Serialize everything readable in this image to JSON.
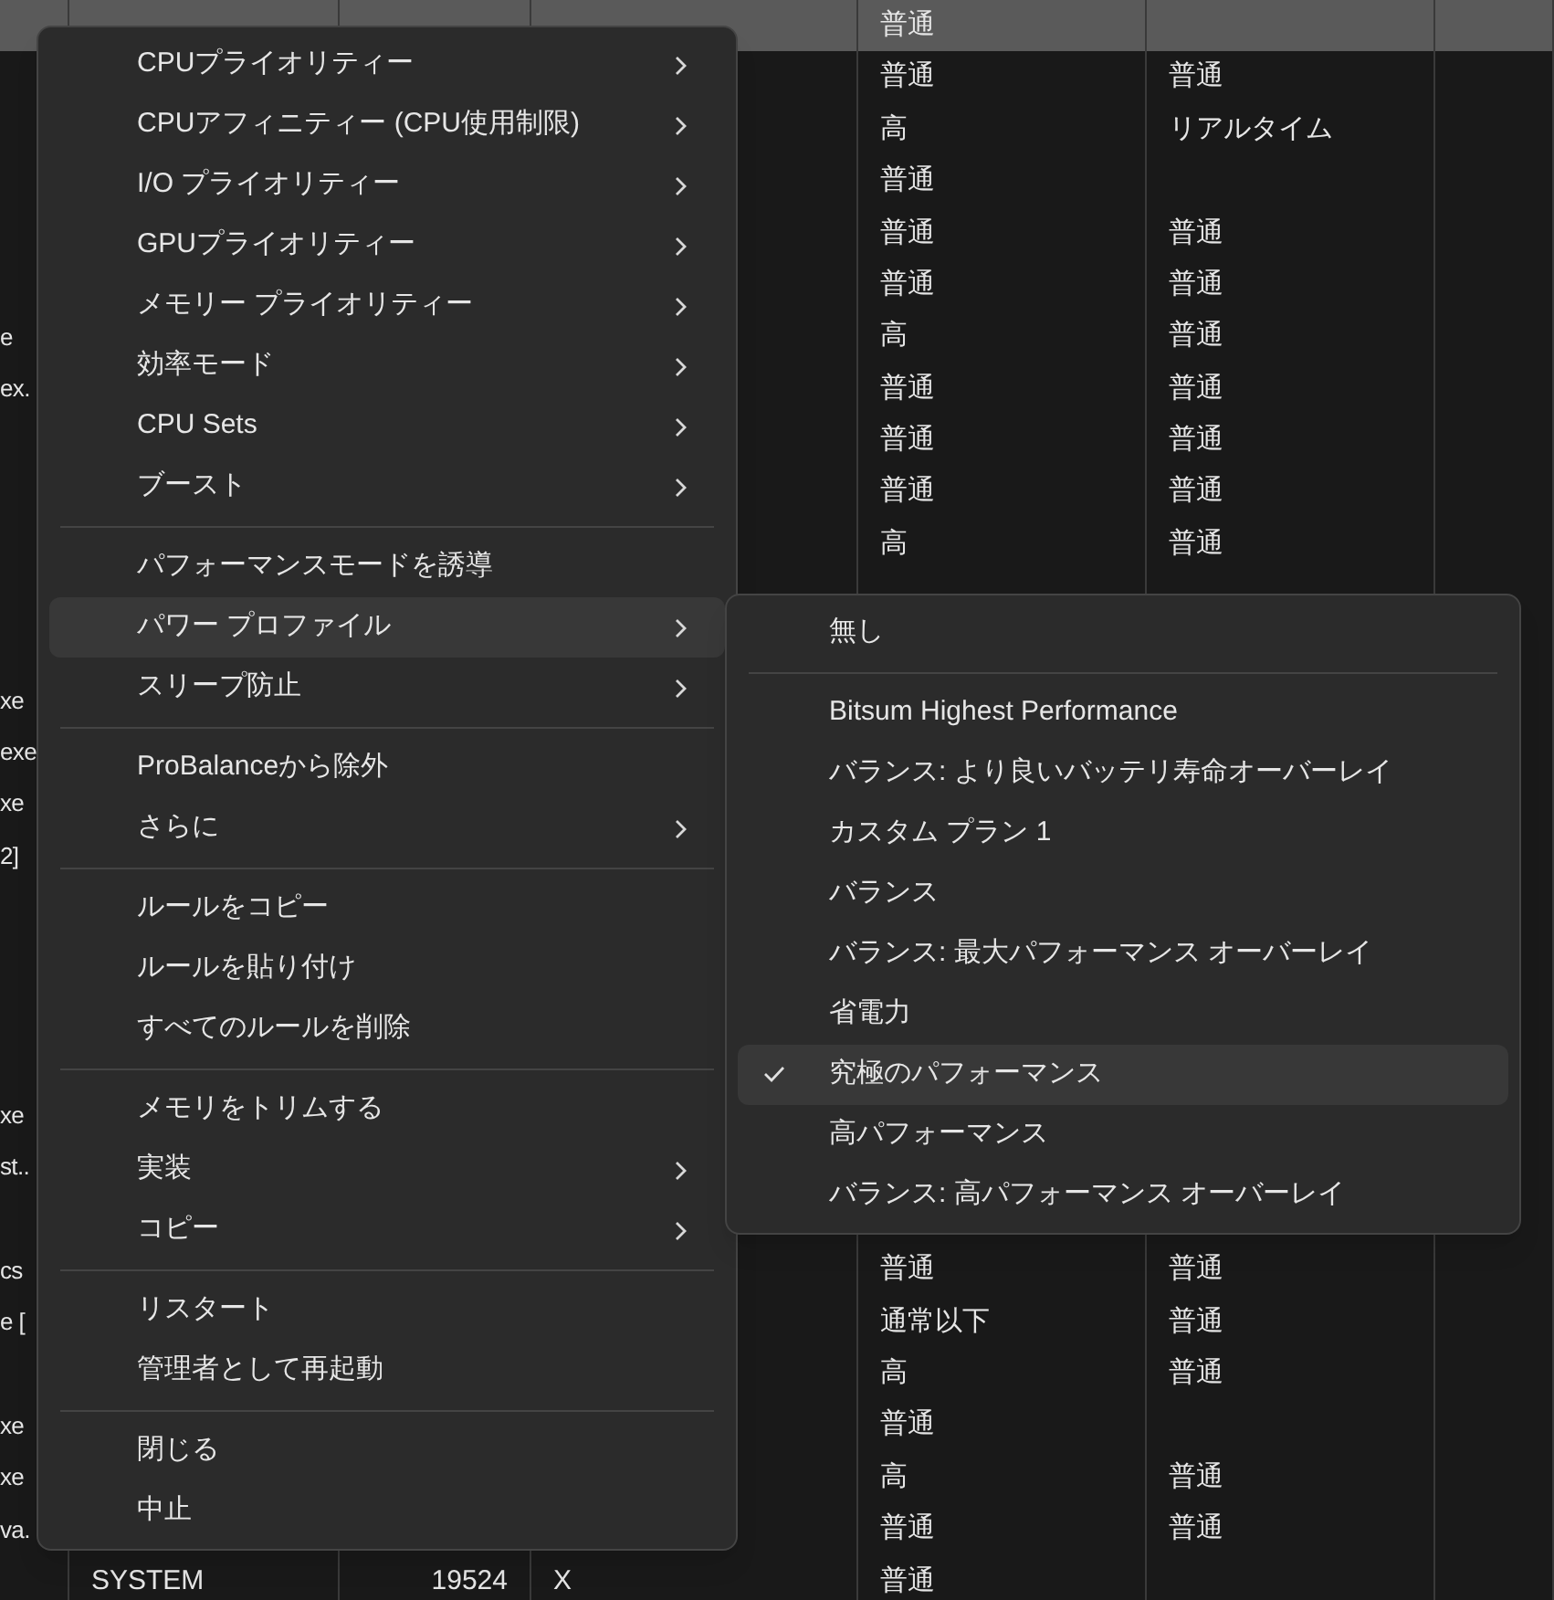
{
  "table": {
    "rows": [
      {
        "selected": true,
        "column_5": "普通"
      },
      {
        "selected": false,
        "column_5": "普通",
        "column_6": "普通"
      },
      {
        "selected": false,
        "column_5": "高",
        "column_6": "リアルタイム"
      },
      {
        "selected": false,
        "column_5": "普通"
      },
      {
        "selected": false,
        "column_5": "普通",
        "column_6": "普通"
      },
      {
        "selected": false,
        "column_5": "普通",
        "column_6": "普通"
      },
      {
        "selected": false,
        "column_1": "e",
        "column_5": "高",
        "column_6": "普通"
      },
      {
        "selected": false,
        "column_1": "ex.",
        "column_5": "普通",
        "column_6": "普通"
      },
      {
        "selected": false,
        "column_5": "普通",
        "column_6": "普通"
      },
      {
        "selected": false,
        "column_5": "普通",
        "column_6": "普通"
      },
      {
        "selected": false,
        "column_5": "高",
        "column_6": "普通"
      },
      {
        "selected": false
      },
      {
        "selected": false
      },
      {
        "selected": false,
        "column_1": "xe"
      },
      {
        "selected": false,
        "column_1": "exe"
      },
      {
        "selected": false,
        "column_1": "xe"
      },
      {
        "selected": false,
        "column_1": "2]"
      },
      {
        "selected": false
      },
      {
        "selected": false
      },
      {
        "selected": false
      },
      {
        "selected": false
      },
      {
        "selected": false,
        "column_1": "xe"
      },
      {
        "selected": false,
        "column_1": "st.."
      },
      {
        "selected": false
      },
      {
        "selected": false,
        "column_1": "cs",
        "column_5": "普通",
        "column_6": "普通"
      },
      {
        "selected": false,
        "column_1": "e [",
        "column_5": "通常以下",
        "column_6": "普通"
      },
      {
        "selected": false,
        "column_5": "高",
        "column_6": "普通"
      },
      {
        "selected": false,
        "column_1": "xe",
        "column_5": "普通"
      },
      {
        "selected": false,
        "column_1": "xe",
        "column_5": "高",
        "column_6": "普通"
      },
      {
        "selected": false,
        "column_1": "va.",
        "column_5": "普通",
        "column_6": "普通"
      },
      {
        "selected": false,
        "column_2": "SYSTEM",
        "column_3": "19524",
        "column_4": "X",
        "column_5": "普通"
      }
    ]
  },
  "context_menu": {
    "groups": [
      [
        {
          "label": "CPUプライオリティー",
          "submenu": true,
          "highlighted": false
        },
        {
          "label": "CPUアフィニティー (CPU使用制限)",
          "submenu": true,
          "highlighted": false
        },
        {
          "label": "I/O プライオリティー",
          "submenu": true,
          "highlighted": false
        },
        {
          "label": "GPUプライオリティー",
          "submenu": true,
          "highlighted": false
        },
        {
          "label": "メモリー プライオリティー",
          "submenu": true,
          "highlighted": false
        },
        {
          "label": "効率モード",
          "submenu": true,
          "highlighted": false
        },
        {
          "label": "CPU Sets",
          "submenu": true,
          "highlighted": false
        },
        {
          "label": "ブースト",
          "submenu": true,
          "highlighted": false
        }
      ],
      [
        {
          "label": "パフォーマンスモードを誘導",
          "submenu": false,
          "highlighted": false
        },
        {
          "label": "パワー プロファイル",
          "submenu": true,
          "highlighted": true
        },
        {
          "label": "スリープ防止",
          "submenu": true,
          "highlighted": false
        }
      ],
      [
        {
          "label": "ProBalanceから除外",
          "submenu": false,
          "highlighted": false
        },
        {
          "label": "さらに",
          "submenu": true,
          "highlighted": false
        }
      ],
      [
        {
          "label": "ルールをコピー",
          "submenu": false,
          "highlighted": false
        },
        {
          "label": "ルールを貼り付け",
          "submenu": false,
          "highlighted": false
        },
        {
          "label": "すべてのルールを削除",
          "submenu": false,
          "highlighted": false
        }
      ],
      [
        {
          "label": "メモリをトリムする",
          "submenu": false,
          "highlighted": false
        },
        {
          "label": "実装",
          "submenu": true,
          "highlighted": false
        },
        {
          "label": "コピー",
          "submenu": true,
          "highlighted": false
        }
      ],
      [
        {
          "label": "リスタート",
          "submenu": false,
          "highlighted": false
        },
        {
          "label": "管理者として再起動",
          "submenu": false,
          "highlighted": false
        }
      ],
      [
        {
          "label": "閉じる",
          "submenu": false,
          "highlighted": false
        },
        {
          "label": "中止",
          "submenu": false,
          "highlighted": false
        }
      ]
    ]
  },
  "power_profile_submenu": {
    "groups": [
      [
        {
          "label": "無し",
          "checked": false
        }
      ],
      [
        {
          "label": "Bitsum Highest Performance",
          "checked": false
        },
        {
          "label": "バランス: より良いバッテリ寿命オーバーレイ",
          "checked": false
        },
        {
          "label": "カスタム プラン 1",
          "checked": false
        },
        {
          "label": "バランス",
          "checked": false
        },
        {
          "label": "バランス: 最大パフォーマンス オーバーレイ",
          "checked": false
        },
        {
          "label": "省電力",
          "checked": false
        },
        {
          "label": "究極のパフォーマンス",
          "checked": true
        },
        {
          "label": "高パフォーマンス",
          "checked": false
        },
        {
          "label": "バランス: 高パフォーマンス オーバーレイ",
          "checked": false
        }
      ]
    ]
  }
}
